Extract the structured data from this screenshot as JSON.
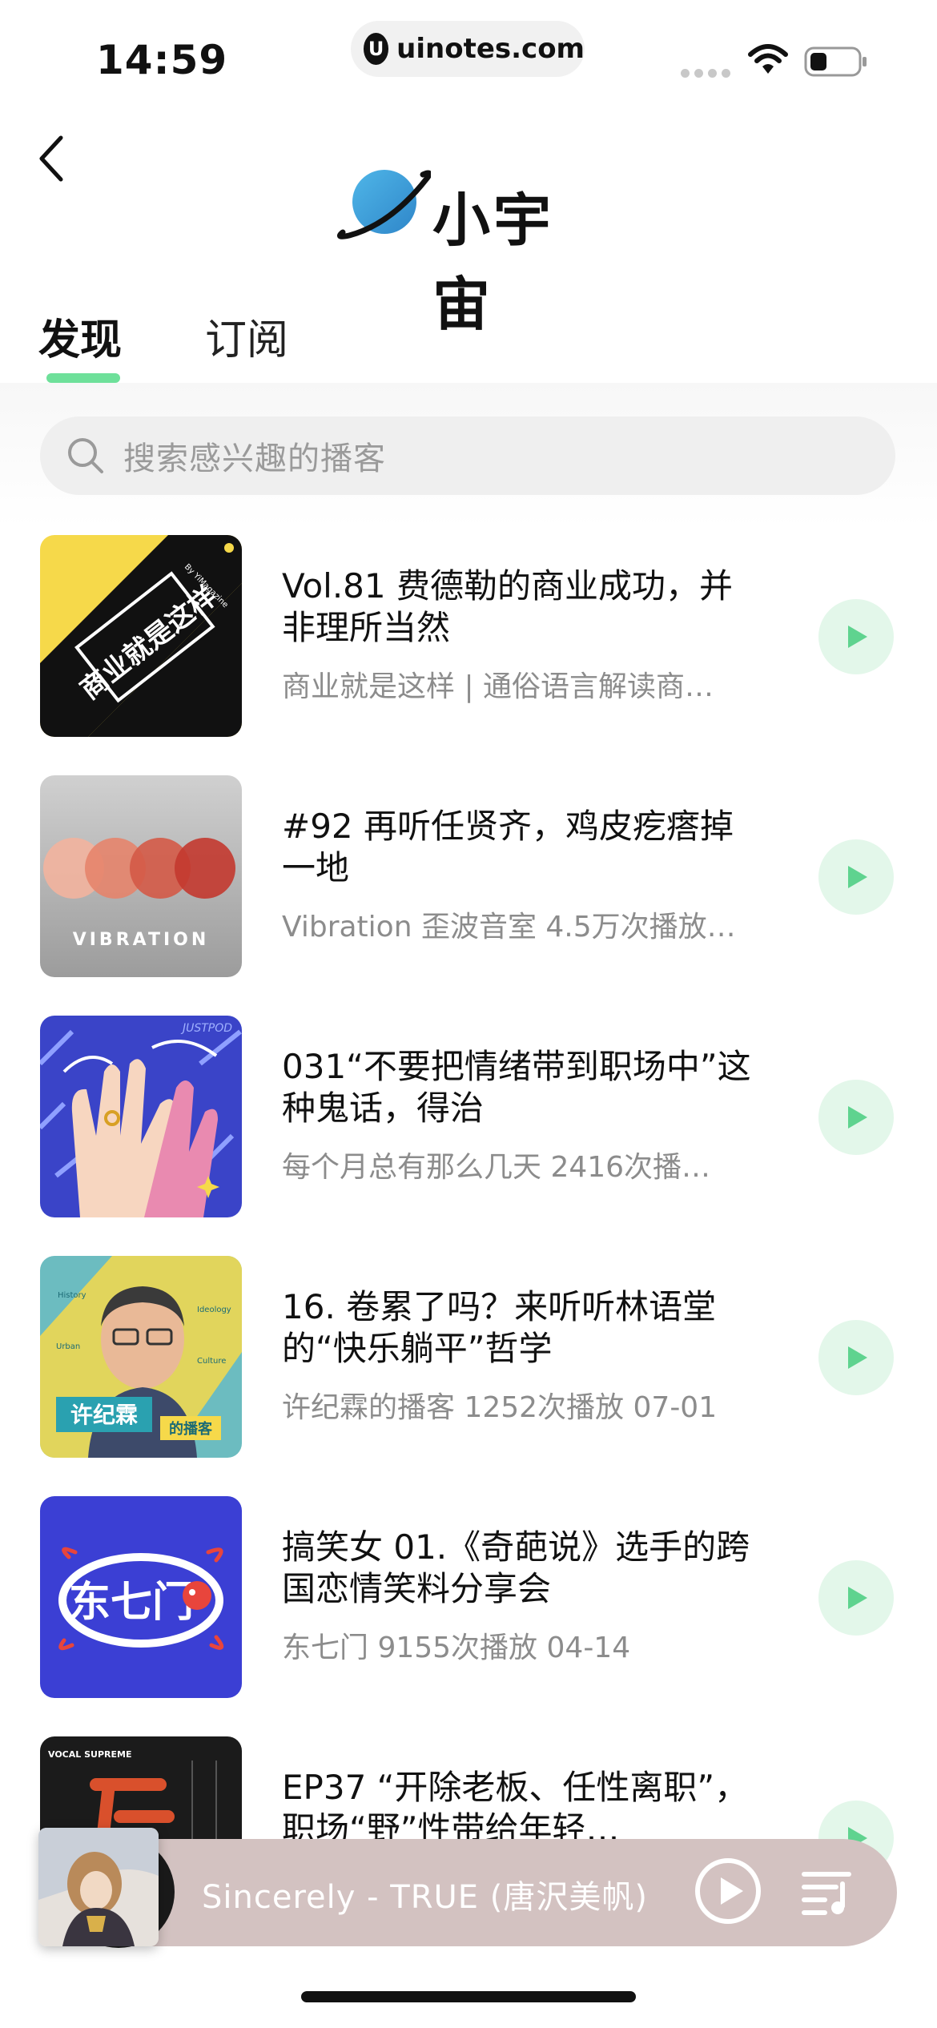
{
  "status_bar": {
    "time": "14:59",
    "url": "uinotes.com",
    "url_logo": "U"
  },
  "header": {
    "app_name": "小宇宙",
    "back_icon": "back-chevron-icon",
    "logo_icon": "planet-icon"
  },
  "tabs": [
    {
      "label": "发现",
      "active": true
    },
    {
      "label": "订阅",
      "active": false
    }
  ],
  "search": {
    "placeholder": "搜索感兴趣的播客"
  },
  "episodes": [
    {
      "title": "Vol.81 费德勒的商业成功，并非理所当然",
      "meta": "商业就是这样 | 通俗语言解读商…",
      "cover_icon": "shangye-cover",
      "cover_text": "商业就是这样",
      "cover_byline": "By YiMagazine"
    },
    {
      "title": "#92 再听任贤齐，鸡皮疙瘩掉一地",
      "meta": "Vibration 歪波音室  4.5万次播放…",
      "cover_icon": "vibration-cover",
      "cover_text": "VIBRATION"
    },
    {
      "title": "031“不要把情绪带到职场中”这种鬼话，得治",
      "meta": "每个月总有那么几天  2416次播…",
      "cover_icon": "hands-cover",
      "cover_text": "JUSTPOD"
    },
    {
      "title": "16. 卷累了吗？来听听林语堂的“快乐躺平”哲学",
      "meta": "许纪霖的播客  1252次播放  07-01",
      "cover_icon": "portrait-cover",
      "cover_text": "许纪霖",
      "cover_tag": "的播客",
      "cover_labels": [
        "History",
        "Ideology",
        "Urban",
        "Culture"
      ]
    },
    {
      "title": "搞笑女 01.《奇葩说》选手的跨国恋情笑料分享会",
      "meta": "东七门  9155次播放  04-14",
      "cover_icon": "dongqimen-cover",
      "cover_text": "东七门"
    },
    {
      "title": "EP37 “开除老板、任性离职”，职场“野”性带给年轻…",
      "meta": "",
      "cover_icon": "vocal-supreme-cover",
      "cover_text": "VOCAL SUPREME"
    }
  ],
  "player": {
    "now_playing": "Sincerely - TRUE (唐沢美帆)",
    "play_icon": "play-circle-icon",
    "playlist_icon": "playlist-icon"
  },
  "colors": {
    "accent_green": "#6ee09a",
    "play_button_bg": "#e3f7ea",
    "player_bg": "#d3c2c1"
  }
}
